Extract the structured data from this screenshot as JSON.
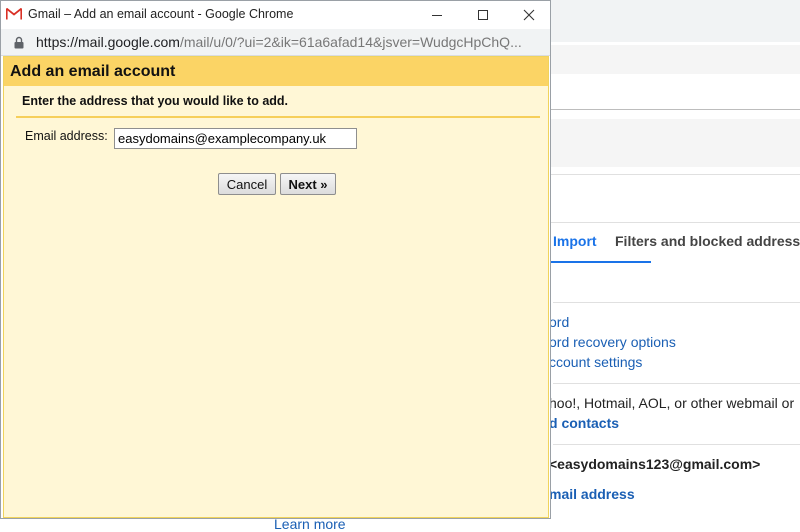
{
  "window": {
    "title": "Gmail – Add an email account - Google Chrome",
    "url_main": "https://mail.google.com",
    "url_rest": "/mail/u/0/?ui=2&ik=61a6afad14&jsver=WudgcHpChQ..."
  },
  "dialog": {
    "title": "Add an email account",
    "instruction": "Enter the address that you would like to add.",
    "email_label": "Email address:",
    "email_value": "easydomains@examplecompany.uk",
    "cancel_label": "Cancel",
    "next_label": "Next »"
  },
  "background": {
    "tab_active": "Import",
    "tab_other": "Filters and blocked address",
    "link_1": "ord",
    "link_2": "ord recovery options",
    "link_3": "ccount settings",
    "import_text": "hoo!, Hotmail, AOL, or other webmail or",
    "import_link": "d contacts",
    "send_as": "<easydomains123@gmail.com>",
    "add_address_link": "mail address",
    "learn_more": "Learn more"
  },
  "colors": {
    "dialog_bg": "#fff7d6",
    "dialog_header": "#fbd465",
    "link": "#1a5fb4",
    "tab_accent": "#1a73e8"
  }
}
